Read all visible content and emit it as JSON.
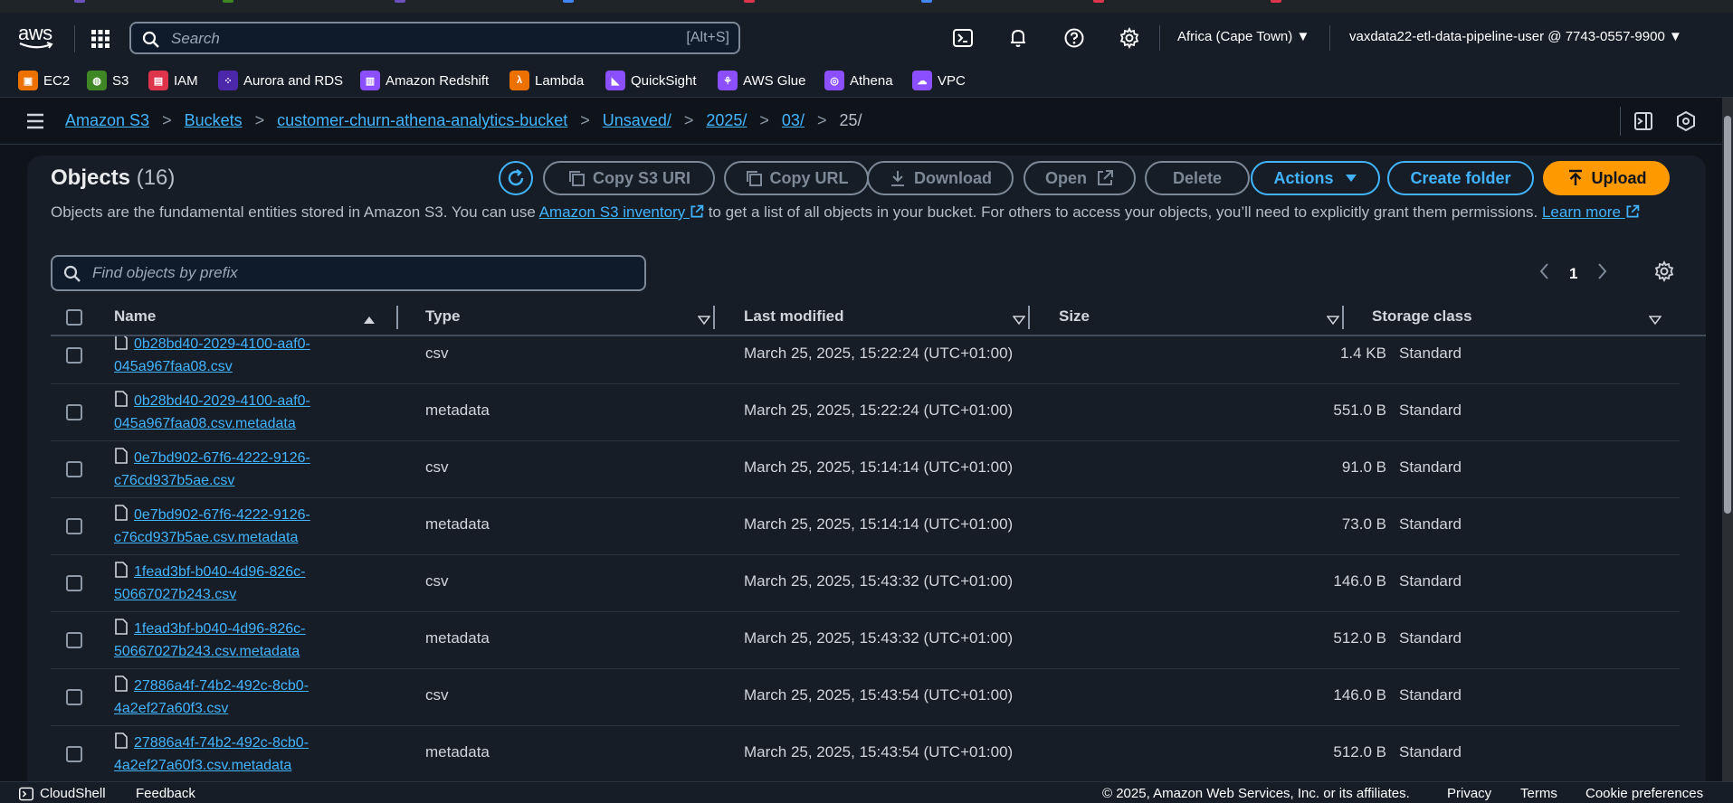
{
  "topnav": {
    "logo_text": "aws",
    "search_placeholder": "Search",
    "search_shortcut": "[Alt+S]",
    "region": "Africa (Cape Town) ▼",
    "account": "vaxdata22-etl-data-pipeline-user @ 7743-0557-9900 ▼"
  },
  "favorites": [
    {
      "label": "EC2",
      "color": "#ed7100",
      "icon": "ec2-icon"
    },
    {
      "label": "S3",
      "color": "#3f8624",
      "icon": "s3-icon"
    },
    {
      "label": "IAM",
      "color": "#dd344c",
      "icon": "iam-icon"
    },
    {
      "label": "Aurora and RDS",
      "color": "#4d27aa",
      "icon": "rds-icon"
    },
    {
      "label": "Amazon Redshift",
      "color": "#8c4fff",
      "icon": "redshift-icon"
    },
    {
      "label": "Lambda",
      "color": "#ed7100",
      "icon": "lambda-icon"
    },
    {
      "label": "QuickSight",
      "color": "#8c4fff",
      "icon": "quicksight-icon"
    },
    {
      "label": "AWS Glue",
      "color": "#8c4fff",
      "icon": "glue-icon"
    },
    {
      "label": "Athena",
      "color": "#8c4fff",
      "icon": "athena-icon"
    },
    {
      "label": "VPC",
      "color": "#8c4fff",
      "icon": "vpc-icon"
    }
  ],
  "breadcrumb": {
    "items": [
      "Amazon S3",
      "Buckets",
      "customer-churn-athena-analytics-bucket",
      "Unsaved/",
      "2025/",
      "03/"
    ],
    "current": "25/"
  },
  "objects": {
    "title": "Objects",
    "count": "(16)",
    "buttons": {
      "copy_s3_uri": "Copy S3 URI",
      "copy_url": "Copy URL",
      "download": "Download",
      "open": "Open",
      "delete": "Delete",
      "actions": "Actions",
      "create_folder": "Create folder",
      "upload": "Upload"
    },
    "description_pre": "Objects are the fundamental entities stored in Amazon S3. You can use ",
    "inventory_link": "Amazon S3 inventory",
    "description_post": " to get a list of all objects in your bucket. For others to access your objects, you’ll need to explicitly grant them permissions. ",
    "learn_more": "Learn more",
    "filter_placeholder": "Find objects by prefix",
    "page": "1"
  },
  "table": {
    "columns": [
      "Name",
      "Type",
      "Last modified",
      "Size",
      "Storage class"
    ],
    "rows": [
      {
        "name_1": "0b28bd40-2029-4100-aaf0-",
        "name_2": "045a967faa08.csv",
        "type": "csv",
        "modified": "March 25, 2025, 15:22:24 (UTC+01:00)",
        "size": "1.4 KB",
        "storage": "Standard"
      },
      {
        "name_1": "0b28bd40-2029-4100-aaf0-",
        "name_2": "045a967faa08.csv.metadata",
        "type": "metadata",
        "modified": "March 25, 2025, 15:22:24 (UTC+01:00)",
        "size": "551.0 B",
        "storage": "Standard"
      },
      {
        "name_1": "0e7bd902-67f6-4222-9126-",
        "name_2": "c76cd937b5ae.csv",
        "type": "csv",
        "modified": "March 25, 2025, 15:14:14 (UTC+01:00)",
        "size": "91.0 B",
        "storage": "Standard"
      },
      {
        "name_1": "0e7bd902-67f6-4222-9126-",
        "name_2": "c76cd937b5ae.csv.metadata",
        "type": "metadata",
        "modified": "March 25, 2025, 15:14:14 (UTC+01:00)",
        "size": "73.0 B",
        "storage": "Standard"
      },
      {
        "name_1": "1fead3bf-b040-4d96-826c-",
        "name_2": "50667027b243.csv",
        "type": "csv",
        "modified": "March 25, 2025, 15:43:32 (UTC+01:00)",
        "size": "146.0 B",
        "storage": "Standard"
      },
      {
        "name_1": "1fead3bf-b040-4d96-826c-",
        "name_2": "50667027b243.csv.metadata",
        "type": "metadata",
        "modified": "March 25, 2025, 15:43:32 (UTC+01:00)",
        "size": "512.0 B",
        "storage": "Standard"
      },
      {
        "name_1": "27886a4f-74b2-492c-8cb0-",
        "name_2": "4a2ef27a60f3.csv",
        "type": "csv",
        "modified": "March 25, 2025, 15:43:54 (UTC+01:00)",
        "size": "146.0 B",
        "storage": "Standard"
      },
      {
        "name_1": "27886a4f-74b2-492c-8cb0-",
        "name_2": "4a2ef27a60f3.csv.metadata",
        "type": "metadata",
        "modified": "March 25, 2025, 15:43:54 (UTC+01:00)",
        "size": "512.0 B",
        "storage": "Standard"
      }
    ]
  },
  "footer": {
    "cloudshell": "CloudShell",
    "feedback": "Feedback",
    "copyright": "© 2025, Amazon Web Services, Inc. or its affiliates.",
    "privacy": "Privacy",
    "terms": "Terms",
    "cookies": "Cookie preferences"
  }
}
